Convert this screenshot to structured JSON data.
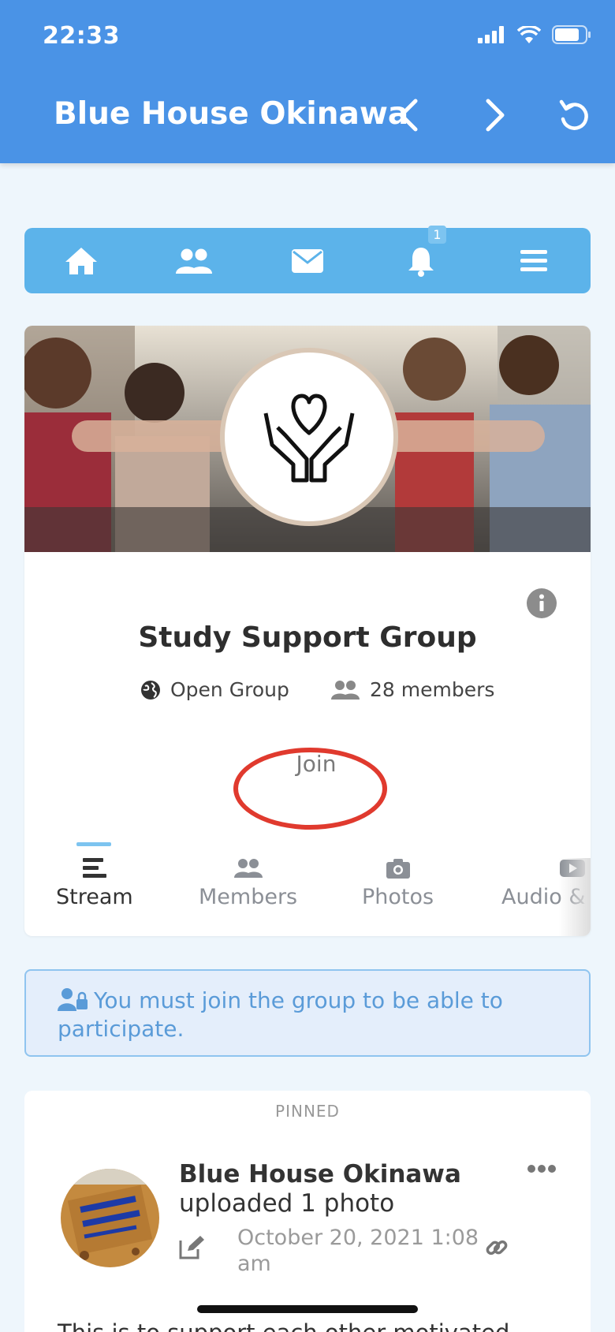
{
  "status": {
    "time": "22:33"
  },
  "header": {
    "title": "Blue House Okinawa"
  },
  "nav": {
    "notification_badge": "1",
    "items": [
      "home-icon",
      "members-icon",
      "mail-icon",
      "bell-icon",
      "menu-icon"
    ]
  },
  "group": {
    "name": "Study Support Group",
    "type": "Open Group",
    "members": "28 members",
    "join_label": "Join"
  },
  "tabs": [
    {
      "label": "Stream"
    },
    {
      "label": "Members"
    },
    {
      "label": "Photos"
    },
    {
      "label": "Audio & Video"
    }
  ],
  "notice": {
    "text": "You must join the group to be able to participate."
  },
  "post": {
    "pinned_label": "PINNED",
    "author": "Blue House Okinawa",
    "action": "uploaded 1 photo",
    "date": "October 20, 2021 1:08 am",
    "body": "This is to support each other motivated"
  },
  "colors": {
    "header": "#4a93e6",
    "nav": "#5cb3ea",
    "join_highlight": "#e03a2e"
  }
}
